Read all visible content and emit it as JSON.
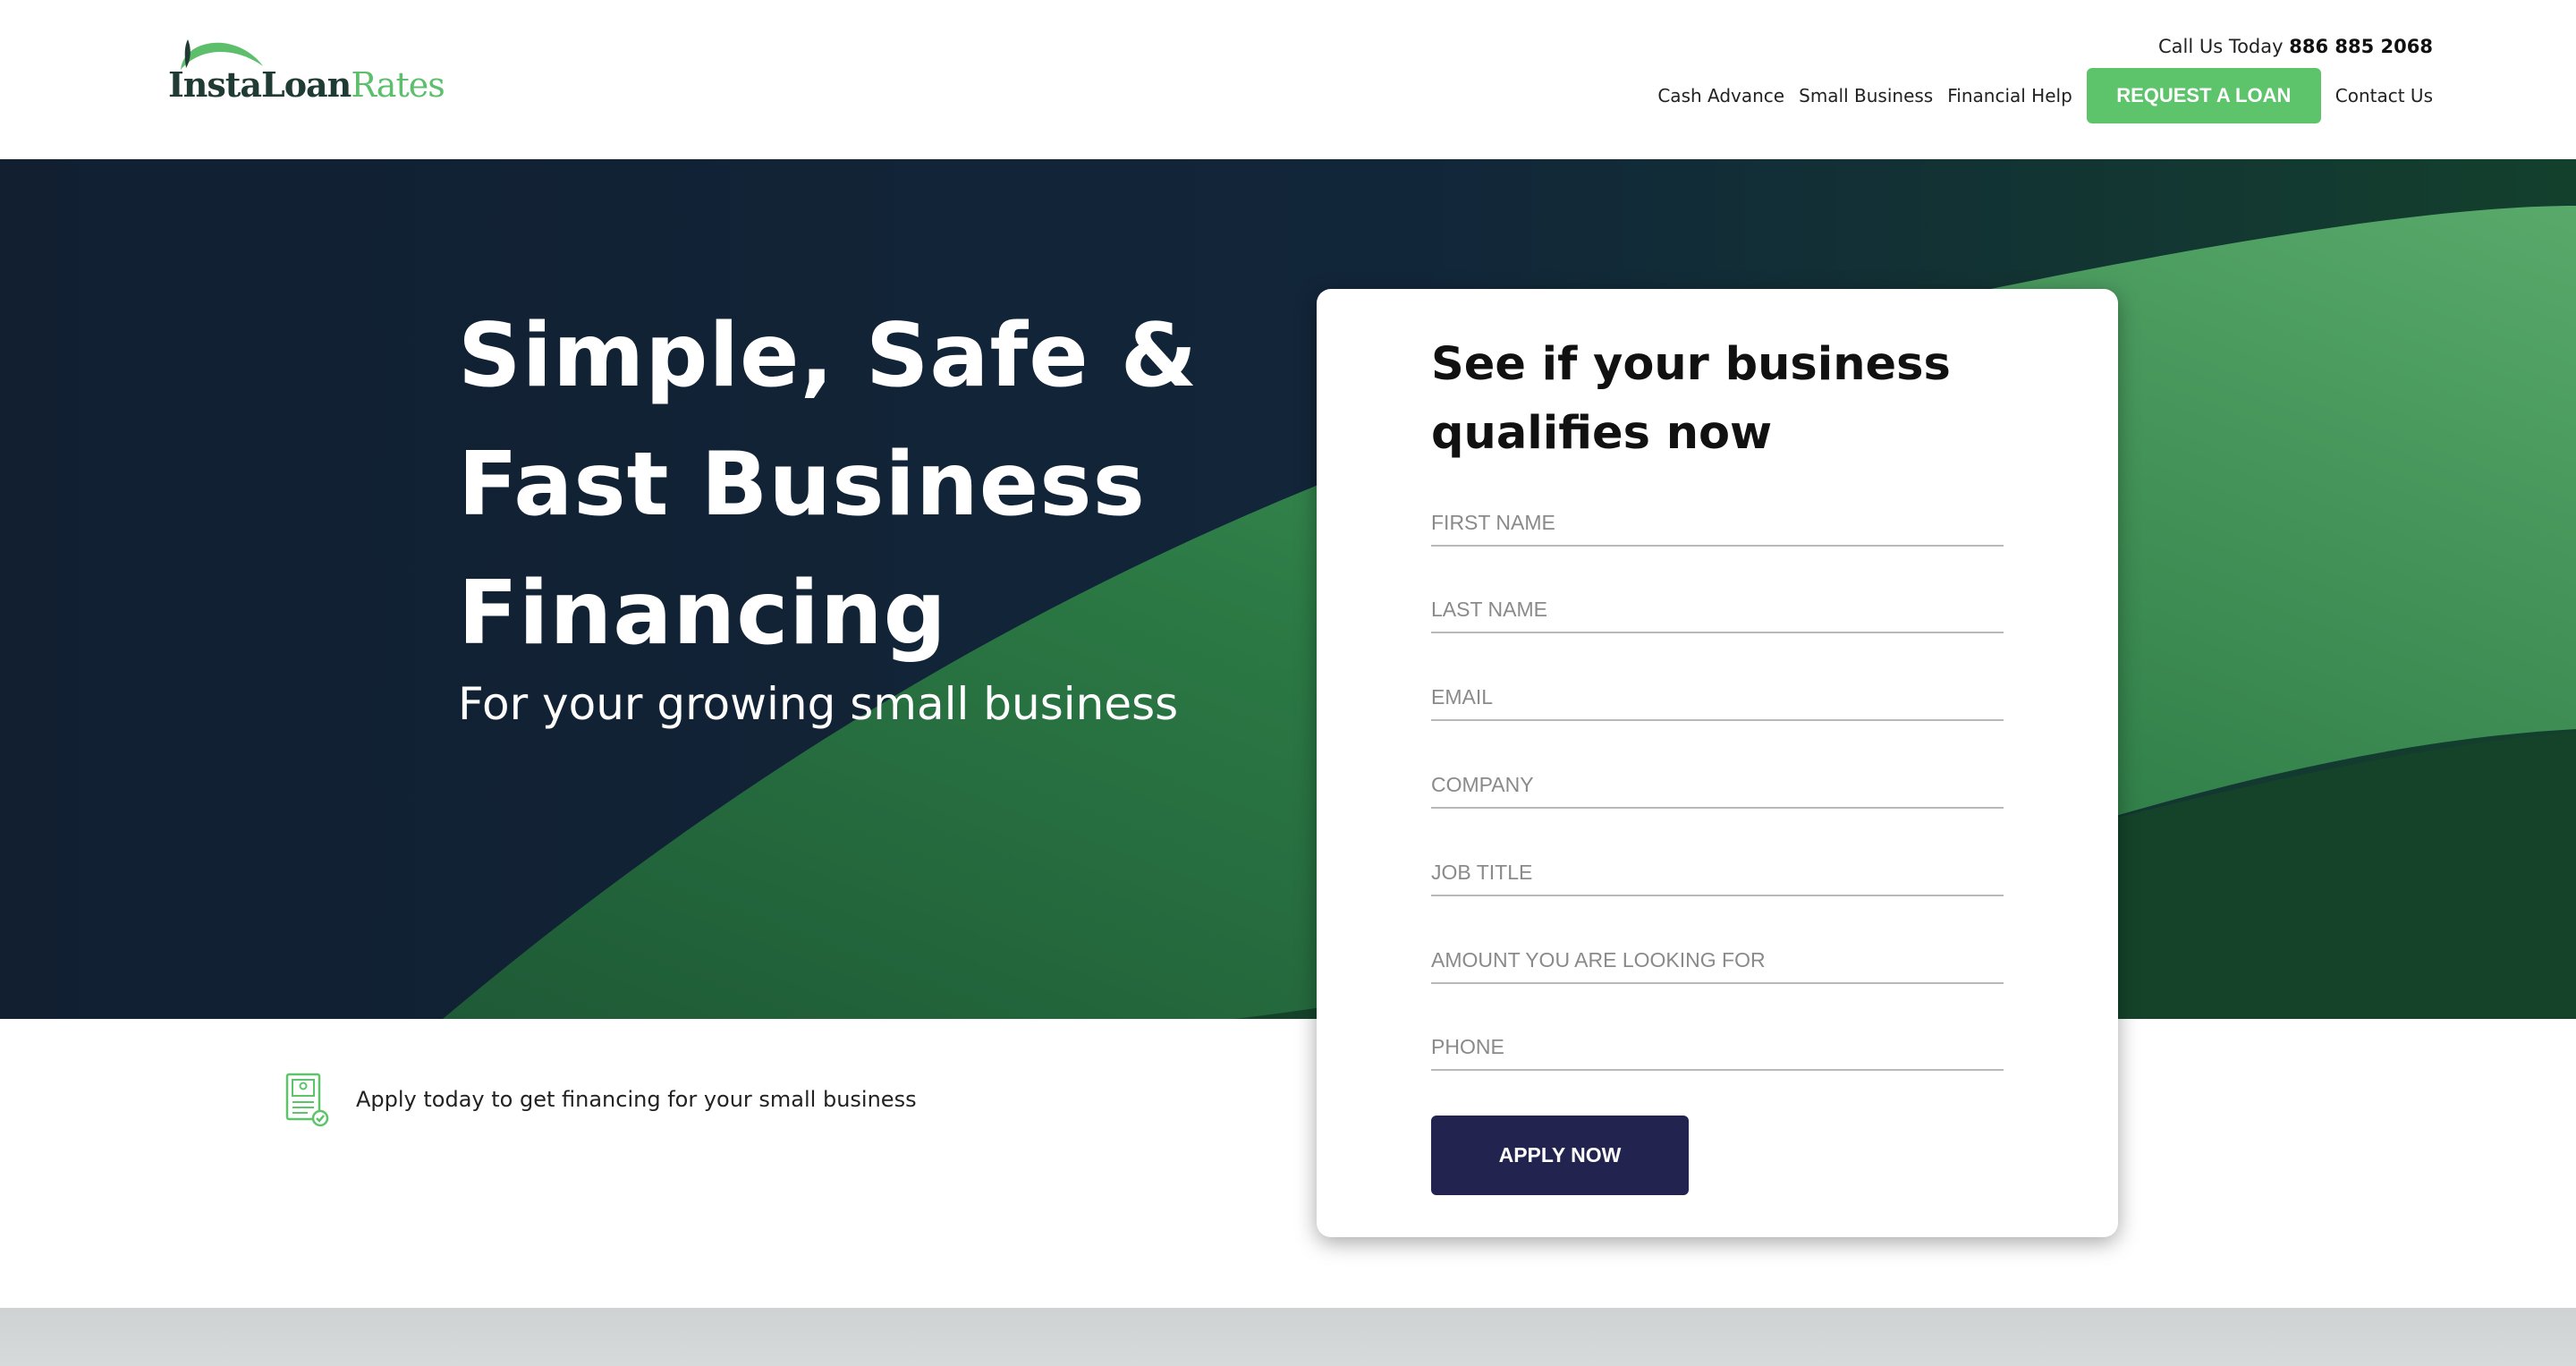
{
  "header": {
    "logo": {
      "part1": "Insta",
      "part2": "Loan",
      "part3": "Rates"
    },
    "call_label": "Call Us Today",
    "phone": "886 885 2068",
    "nav": [
      {
        "label": "Cash Advance"
      },
      {
        "label": "Small Business"
      },
      {
        "label": "Financial Help"
      }
    ],
    "cta_label": "REQUEST A LOAN",
    "contact_label": "Contact Us"
  },
  "hero": {
    "title": "Simple, Safe & Fast Business Financing",
    "subtitle": "For your growing small business"
  },
  "feature": {
    "icon": "document-check-icon",
    "text": "Apply today to get financing for your small business"
  },
  "form": {
    "title": "See if your business qualifies now",
    "fields": [
      {
        "placeholder": "FIRST NAME",
        "value": ""
      },
      {
        "placeholder": "LAST NAME",
        "value": ""
      },
      {
        "placeholder": "EMAIL",
        "value": ""
      },
      {
        "placeholder": "COMPANY",
        "value": ""
      },
      {
        "placeholder": "JOB TITLE",
        "value": ""
      },
      {
        "placeholder": "AMOUNT YOU ARE LOOKING FOR",
        "value": ""
      },
      {
        "placeholder": "PHONE",
        "value": ""
      }
    ],
    "submit_label": "APPLY NOW"
  },
  "colors": {
    "brand_green": "#5ec46c",
    "hero_navy": "#122133",
    "button_navy": "#22234f"
  }
}
